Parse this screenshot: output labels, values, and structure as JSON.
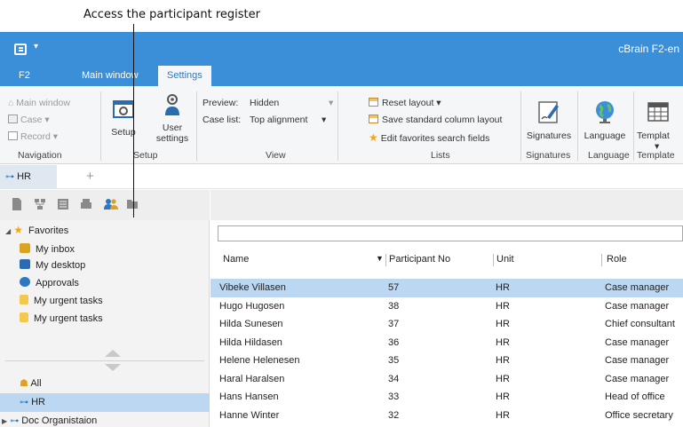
{
  "annotation": {
    "callout": "Access the participant register"
  },
  "titlebar": {
    "dropdown_glyph": "▾",
    "app_title": "cBrain F2-en"
  },
  "ribbon_tabs": [
    {
      "label": "F2"
    },
    {
      "label": "Main window"
    },
    {
      "label": "Settings"
    }
  ],
  "ribbon": {
    "navigation": {
      "label": "Navigation",
      "main_window": "Main window",
      "case": "Case ▾",
      "record": "Record ▾"
    },
    "setup_group": {
      "label": "Setup",
      "setup": "Setup",
      "user_settings_line1": "User",
      "user_settings_line2": "settings"
    },
    "view": {
      "label": "View",
      "preview_label": "Preview:",
      "preview_value": "Hidden",
      "case_list_label": "Case list:",
      "case_list_value": "Top alignment",
      "dropdown_glyph": "▾"
    },
    "lists": {
      "label": "Lists",
      "reset_layout": "Reset layout ▾",
      "save_standard": "Save standard column layout",
      "edit_favorites": "Edit favorites search fields"
    },
    "signatures": {
      "label": "Signatures",
      "button": "Signatures"
    },
    "language": {
      "label": "Language",
      "button": "Language"
    },
    "templates": {
      "label": "Template",
      "button_line1": "Templat",
      "button_line2": "▾"
    }
  },
  "workspace_tabs": {
    "active": "HR",
    "add": "+"
  },
  "favorites": {
    "title": "Favorites",
    "items": [
      {
        "label": "My inbox",
        "color": "#d9a520"
      },
      {
        "label": "My desktop",
        "color": "#2b6cb0"
      },
      {
        "label": "Approvals",
        "color": "#2b79c2"
      },
      {
        "label": "My urgent tasks",
        "color": "#f2c94c"
      },
      {
        "label": "My urgent tasks",
        "color": "#f2c94c"
      }
    ]
  },
  "units": {
    "items": [
      {
        "label": "All",
        "selected": false
      },
      {
        "label": "HR",
        "selected": true
      },
      {
        "label": "Doc Organistaion",
        "selected": false
      }
    ]
  },
  "table": {
    "columns": [
      "Name",
      "Participant No",
      "Unit",
      "Role"
    ],
    "sort_glyph": "▼",
    "rows": [
      {
        "name": "Vibeke Villasen",
        "no": "57",
        "unit": "HR",
        "role": "Case manager",
        "selected": true
      },
      {
        "name": "Hugo Hugosen",
        "no": "38",
        "unit": "HR",
        "role": "Case manager",
        "selected": false
      },
      {
        "name": "Hilda Sunesen",
        "no": "37",
        "unit": "HR",
        "role": "Chief consultant",
        "selected": false
      },
      {
        "name": "Hilda Hildasen",
        "no": "36",
        "unit": "HR",
        "role": "Case manager",
        "selected": false
      },
      {
        "name": "Helene Helenesen",
        "no": "35",
        "unit": "HR",
        "role": "Case manager",
        "selected": false
      },
      {
        "name": "Haral Haralsen",
        "no": "34",
        "unit": "HR",
        "role": "Case manager",
        "selected": false
      },
      {
        "name": "Hans Hansen",
        "no": "33",
        "unit": "HR",
        "role": "Head of office",
        "selected": false
      },
      {
        "name": "Hanne Winter",
        "no": "32",
        "unit": "HR",
        "role": "Office secretary",
        "selected": false
      }
    ]
  },
  "colors": {
    "titlebar": "#3a8fd8",
    "selection": "#bcd7f1",
    "accent": "#2b79c2"
  }
}
